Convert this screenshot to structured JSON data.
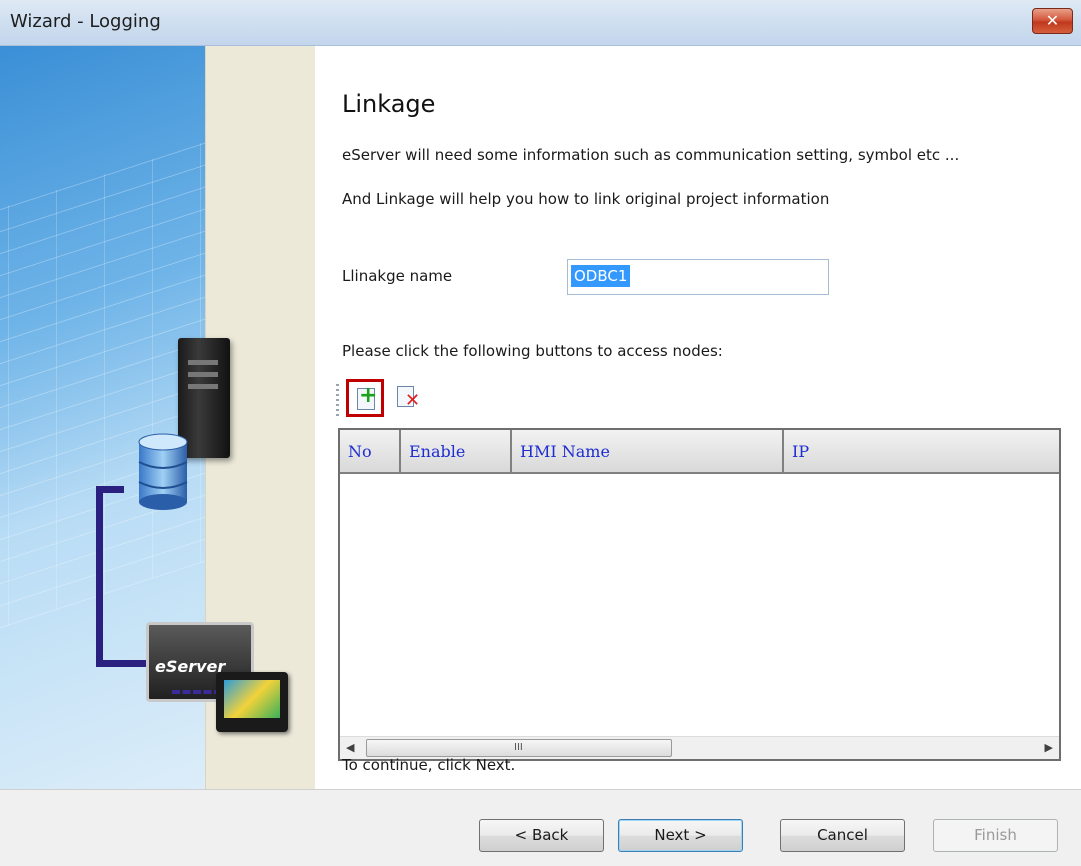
{
  "window": {
    "title": "Wizard - Logging",
    "close_glyph": "✕"
  },
  "banner": {
    "eserver_label": "eServer"
  },
  "page": {
    "title": "Linkage",
    "description_1": "eServer will need some information such as communication setting, symbol etc ...",
    "description_2": "And Linkage will help you how to link original project information"
  },
  "linkage_name": {
    "label": "Llinakge name",
    "value": "ODBC1"
  },
  "nodes": {
    "label": "Please click the following buttons to access nodes:",
    "add_icon": "add-node-icon",
    "delete_icon": "delete-node-icon",
    "table": {
      "columns": [
        "No",
        "Enable",
        "HMI Name",
        "IP"
      ],
      "rows": []
    },
    "scroll_grip": "III"
  },
  "footer": {
    "hint": "To continue, click Next."
  },
  "buttons": {
    "back": "< Back",
    "next": "Next >",
    "cancel": "Cancel",
    "finish": "Finish"
  },
  "colors": {
    "header_text": "#1e2dd0",
    "highlight": "#c00000",
    "selection": "#3399ff"
  }
}
